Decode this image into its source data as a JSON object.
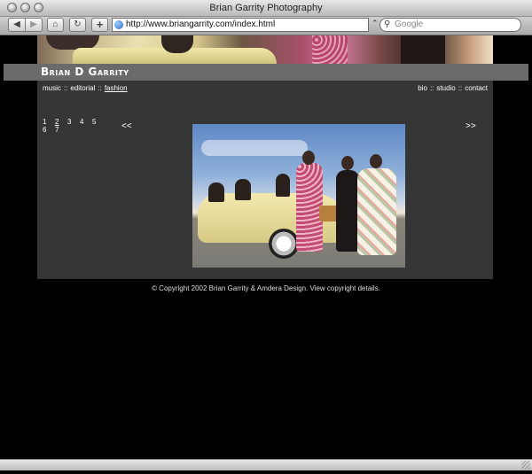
{
  "window": {
    "title": "Brian Garrity Photography"
  },
  "toolbar": {
    "back_icon": "back-arrow-icon",
    "forward_icon": "forward-arrow-icon",
    "url": "http://www.briangarrity.com/index.html",
    "search_placeholder": "Google"
  },
  "site": {
    "name": "Brian D Garrity",
    "nav_left": [
      {
        "label": "music"
      },
      {
        "label": "editorial"
      },
      {
        "label": "fashion",
        "active": true
      }
    ],
    "nav_right": [
      {
        "label": "bio"
      },
      {
        "label": "studio"
      },
      {
        "label": "contact"
      }
    ],
    "separator": "::",
    "pages": [
      "1",
      "2",
      "3",
      "4",
      "5",
      "6",
      "7"
    ],
    "active_page": "2",
    "prev_label": "<<",
    "next_label": ">>",
    "footer": "© Copyright 2002 Brian Garrity & Amdera Design. View copyright details."
  }
}
